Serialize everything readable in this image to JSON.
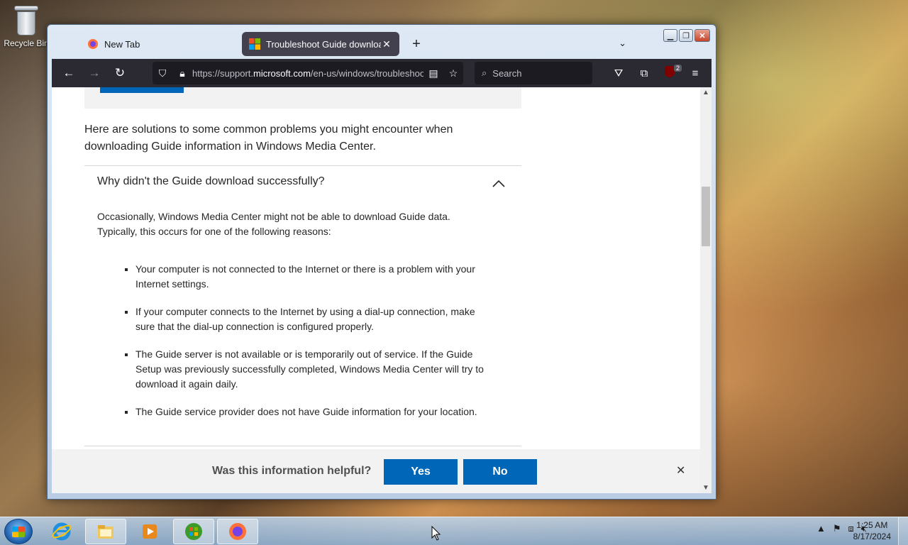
{
  "desktop": {
    "recycle_bin_label": "Recycle Bin"
  },
  "browser": {
    "tabs": [
      {
        "label": "New Tab",
        "favicon": "firefox-icon"
      },
      {
        "label": "Troubleshoot Guide download",
        "favicon": "microsoft-icon",
        "active": true
      }
    ],
    "new_tab_symbol": "+",
    "url_prefix": "https://support.",
    "url_domain": "microsoft.com",
    "url_rest": "/en-us/windows/troubleshoot",
    "search_placeholder": "Search",
    "extension_badge": "2",
    "accent": "#2b2a33"
  },
  "page": {
    "intro": "Here are solutions to some common problems you might encounter when downloading Guide information in Windows Media Center.",
    "accordion_title": "Why didn't the Guide download successfully?",
    "accordion_paragraph": "Occasionally, Windows Media Center might not be able to download Guide data. Typically, this occurs for one of the following reasons:",
    "reasons": [
      "Your computer is not connected to the Internet or there is a problem with your Internet settings.",
      "If your computer connects to the Internet by using a dial-up connection, make sure that the dial-up connection is configured properly.",
      "The Guide server is not available or is temporarily out of service. If the Guide Setup was previously successfully completed, Windows Media Center will try to download it again daily.",
      "The Guide service provider does not have Guide information for your location."
    ],
    "brand_blue": "#0067b8"
  },
  "feedback": {
    "question": "Was this information helpful?",
    "yes": "Yes",
    "no": "No"
  },
  "taskbar": {
    "time": "1:25 AM",
    "date": "8/17/2024",
    "pinned": [
      "internet-explorer-icon",
      "file-explorer-icon",
      "media-player-icon",
      "windows-media-center-icon",
      "firefox-icon"
    ]
  }
}
